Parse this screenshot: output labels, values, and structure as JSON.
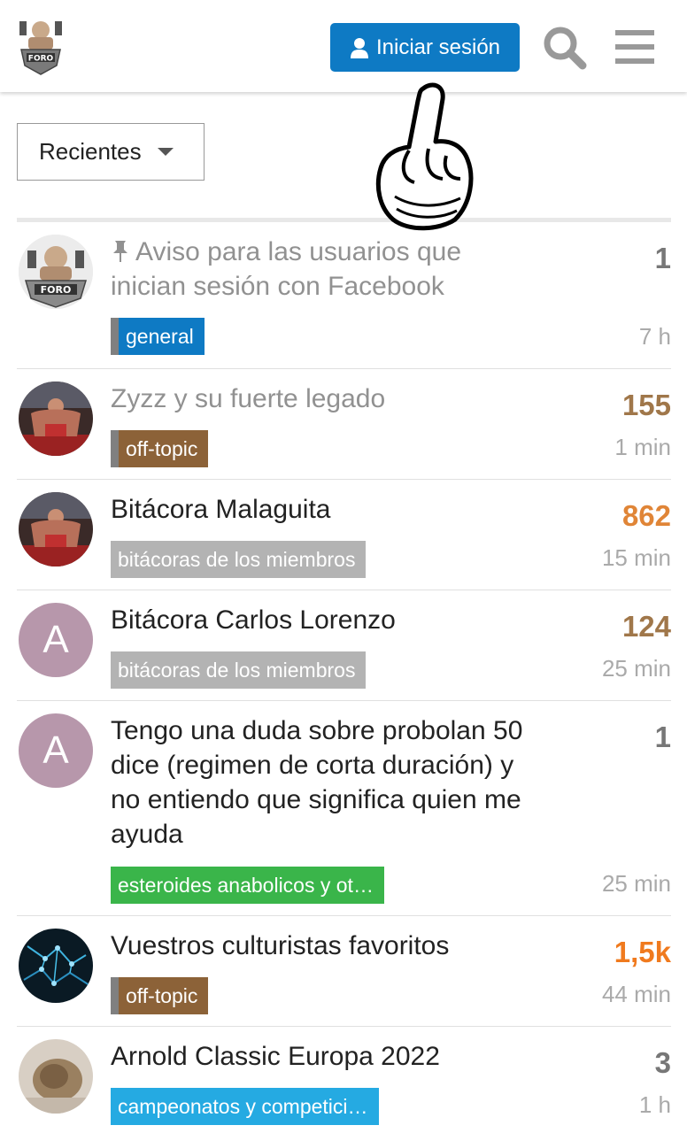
{
  "header": {
    "logo_alt": "FORO",
    "login_label": "Iniciar sesión"
  },
  "filter": {
    "label": "Recientes"
  },
  "colors": {
    "accent": "#0e7ac4",
    "general": "#0e7ac4",
    "offtopic": "#8c6238",
    "miembros": "#b3b3b3",
    "esteroides": "#3ab54a",
    "campeonatos": "#25aae2",
    "replies_hot": "#e08537",
    "replies_warm": "#a0774a",
    "replies_normal": "#777777"
  },
  "topics": [
    {
      "title": "Aviso para las usuarios que inician sesión con Facebook",
      "pinned": true,
      "visited": true,
      "category": "general",
      "replies": "1",
      "age": "7 h",
      "avatar": "logo"
    },
    {
      "title": "Zyzz y su fuerte legado",
      "visited": true,
      "category": "off-topic",
      "replies": "155",
      "age": "1 min",
      "avatar": "photo-gym"
    },
    {
      "title": "Bitácora Malaguita",
      "category": "bitácoras de los miembros",
      "replies": "862",
      "age": "15 min",
      "avatar": "photo-gym"
    },
    {
      "title": "Bitácora Carlos Lorenzo",
      "category": "bitácoras de los miembros",
      "replies": "124",
      "age": "25 min",
      "avatar": "A"
    },
    {
      "title": "Tengo una duda sobre probolan 50 dice (regimen de corta duración) y no entiendo que significa quien me ayuda",
      "category": "esteroides anabolicos y ot…",
      "replies": "1",
      "age": "25 min",
      "avatar": "A"
    },
    {
      "title": "Vuestros culturistas favoritos",
      "category": "off-topic",
      "replies": "1,5k",
      "age": "44 min",
      "avatar": "photo-neurons"
    },
    {
      "title": "Arnold Classic Europa 2022",
      "category": "campeonatos y competici…",
      "replies": "3",
      "age": "1 h",
      "avatar": "photo-face"
    }
  ]
}
